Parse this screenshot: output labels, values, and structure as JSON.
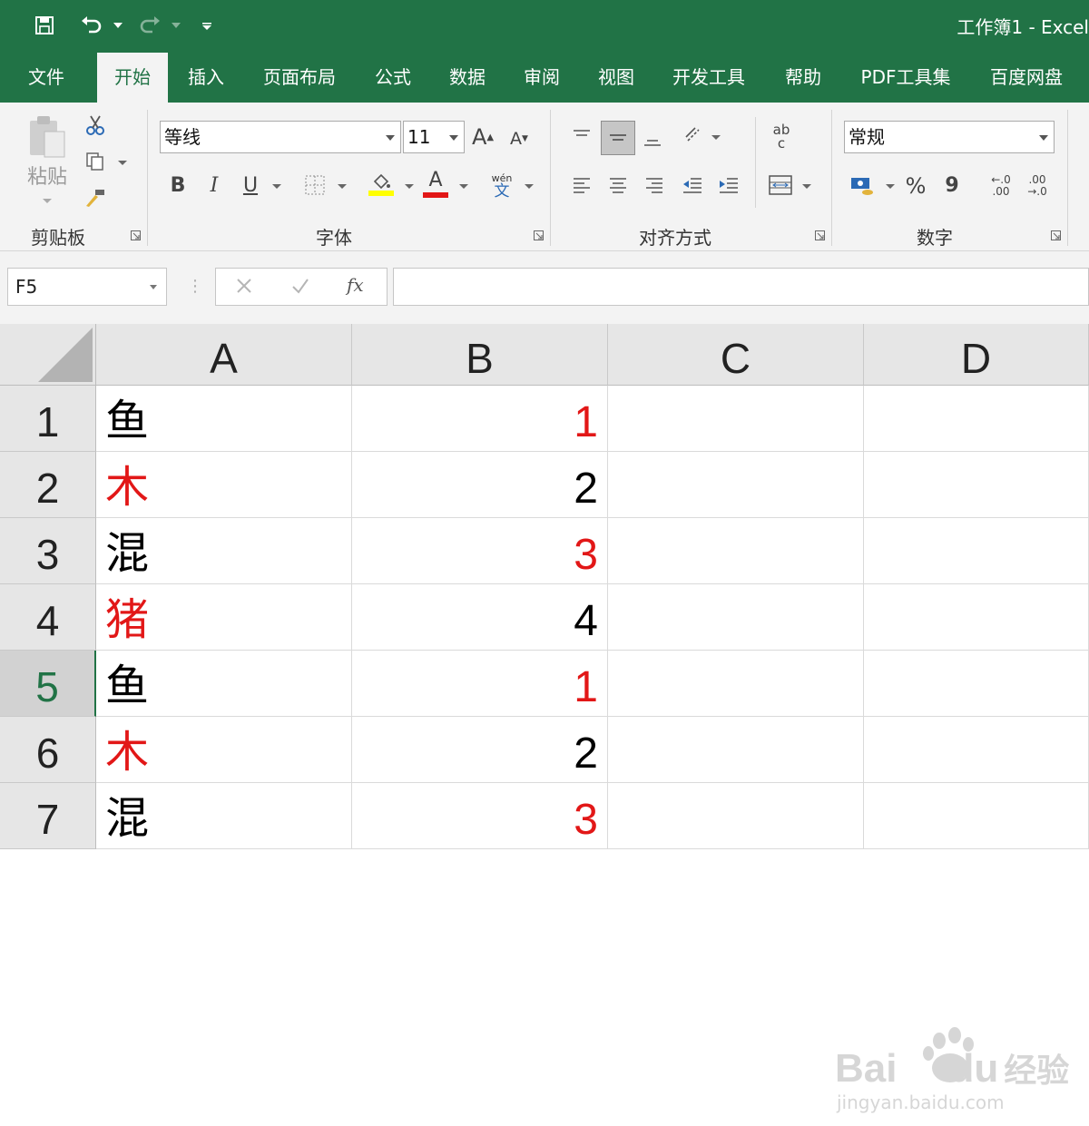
{
  "window": {
    "title": "工作簿1  -  Excel"
  },
  "tabs": [
    "文件",
    "开始",
    "插入",
    "页面布局",
    "公式",
    "数据",
    "审阅",
    "视图",
    "开发工具",
    "帮助",
    "PDF工具集",
    "百度网盘"
  ],
  "active_tab": "开始",
  "ribbon": {
    "clipboard": {
      "label": "剪贴板",
      "paste_label": "粘贴"
    },
    "font": {
      "label": "字体",
      "name": "等线",
      "size": "11",
      "bold": "B",
      "italic": "I",
      "underline": "U",
      "grow": "A",
      "shrink": "A",
      "color_letter": "A",
      "phonetic": "wén",
      "phonetic_char": "文"
    },
    "alignment": {
      "label": "对齐方式",
      "wrap": "ab",
      "wrap2": "c"
    },
    "number": {
      "label": "数字",
      "format": "常规",
      "percent": "%",
      "comma": "9",
      "inc_decimal_top": "←.0",
      "inc_decimal_bot": ".00",
      "dec_decimal_top": ".00",
      "dec_decimal_bot": "→.0"
    },
    "colors": {
      "fill_yellow": "#ffff00",
      "font_red": "#e21717",
      "accent": "#217346"
    }
  },
  "formula_bar": {
    "name_box": "F5",
    "fx": "fx",
    "value": ""
  },
  "columns": [
    "A",
    "B",
    "C",
    "D"
  ],
  "rows": [
    {
      "num": "1",
      "a": "鱼",
      "a_color": "#000000",
      "b": "1",
      "b_color": "#e21717"
    },
    {
      "num": "2",
      "a": "木",
      "a_color": "#e21717",
      "b": "2",
      "b_color": "#000000"
    },
    {
      "num": "3",
      "a": "混",
      "a_color": "#000000",
      "b": "3",
      "b_color": "#e21717"
    },
    {
      "num": "4",
      "a": "猪",
      "a_color": "#e21717",
      "b": "4",
      "b_color": "#000000"
    },
    {
      "num": "5",
      "a": "鱼",
      "a_color": "#000000",
      "b": "1",
      "b_color": "#e21717"
    },
    {
      "num": "6",
      "a": "木",
      "a_color": "#e21717",
      "b": "2",
      "b_color": "#000000"
    },
    {
      "num": "7",
      "a": "混",
      "a_color": "#000000",
      "b": "3",
      "b_color": "#e21717"
    }
  ],
  "selected_row": "5",
  "watermark": {
    "brand": "Bai",
    "brand2": "du",
    "brand_cn": "经验",
    "url": "jingyan.baidu.com"
  }
}
